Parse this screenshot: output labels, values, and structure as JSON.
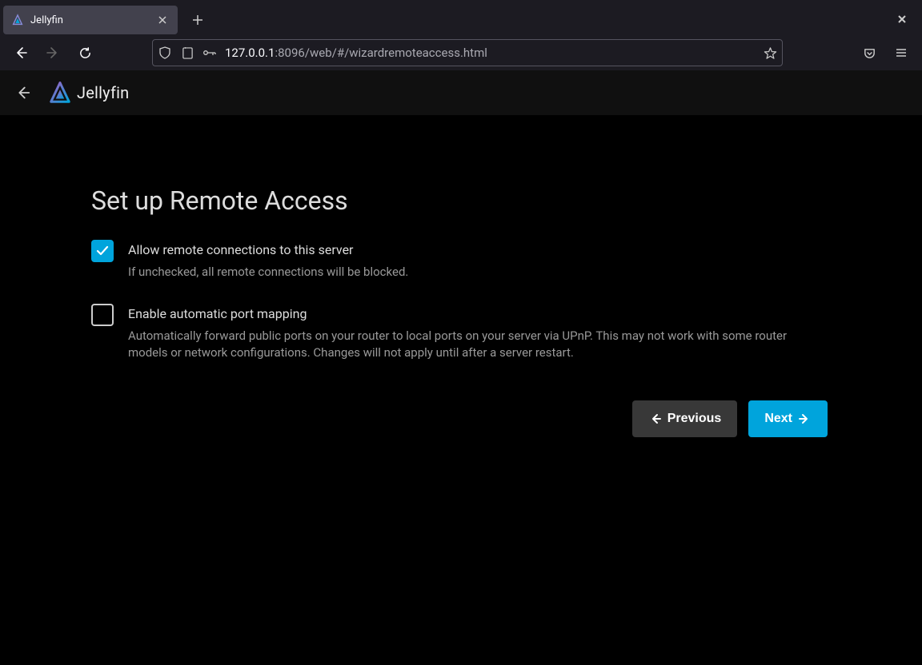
{
  "browser": {
    "tab_title": "Jellyfin",
    "url_host": "127.0.0.1",
    "url_rest": ":8096/web/#/wizardremoteaccess.html"
  },
  "header": {
    "brand": "Jellyfin"
  },
  "wizard": {
    "title": "Set up Remote Access",
    "option1": {
      "label": "Allow remote connections to this server",
      "desc": "If unchecked, all remote connections will be blocked.",
      "checked": true
    },
    "option2": {
      "label": "Enable automatic port mapping",
      "desc": "Automatically forward public ports on your router to local ports on your server via UPnP. This may not work with some router models or network configurations. Changes will not apply until after a server restart.",
      "checked": false
    },
    "buttons": {
      "previous": "Previous",
      "next": "Next"
    }
  }
}
